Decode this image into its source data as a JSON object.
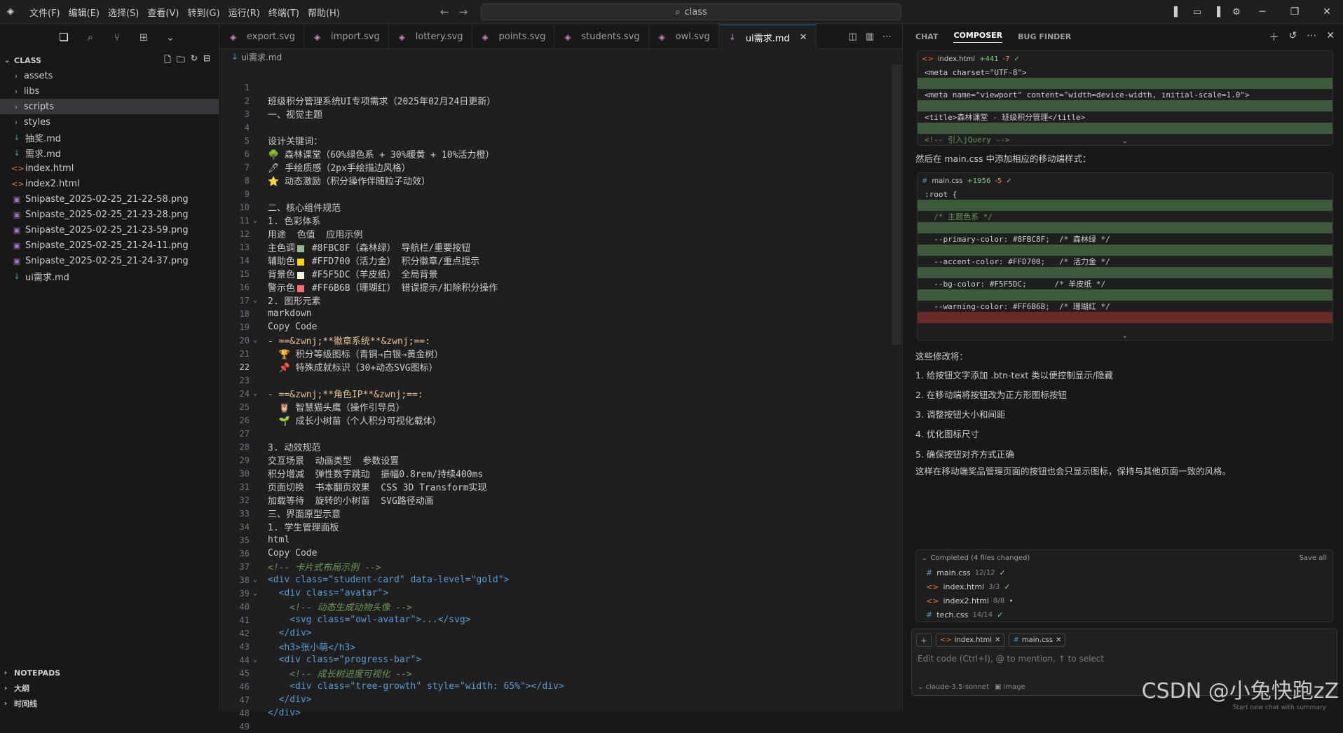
{
  "menus": [
    "文件(F)",
    "编辑(E)",
    "选择(S)",
    "查看(V)",
    "转到(G)",
    "运行(R)",
    "终端(T)",
    "帮助(H)"
  ],
  "search": {
    "label": "class"
  },
  "sidebar": {
    "root": "CLASS",
    "items": [
      {
        "label": "assets",
        "type": "folder"
      },
      {
        "label": "libs",
        "type": "folder"
      },
      {
        "label": "scripts",
        "type": "folder"
      },
      {
        "label": "styles",
        "type": "folder"
      },
      {
        "label": "抽奖.md",
        "type": "md"
      },
      {
        "label": "需求.md",
        "type": "md"
      },
      {
        "label": "index.html",
        "type": "html"
      },
      {
        "label": "index2.html",
        "type": "html"
      },
      {
        "label": "Snipaste_2025-02-25_21-22-58.png",
        "type": "png"
      },
      {
        "label": "Snipaste_2025-02-25_21-23-28.png",
        "type": "png"
      },
      {
        "label": "Snipaste_2025-02-25_21-23-59.png",
        "type": "png"
      },
      {
        "label": "Snipaste_2025-02-25_21-24-11.png",
        "type": "png"
      },
      {
        "label": "Snipaste_2025-02-25_21-24-37.png",
        "type": "png"
      },
      {
        "label": "ui需求.md",
        "type": "md"
      }
    ],
    "bottom": [
      "NOTEPADS",
      "大纲",
      "时间线"
    ]
  },
  "tabs": [
    "export.svg",
    "import.svg",
    "lottery.svg",
    "points.svg",
    "students.svg",
    "owl.svg",
    "ui需求.md"
  ],
  "breadcrumb": "ui需求.md",
  "code": [
    {
      "n": "1",
      "t": ""
    },
    {
      "n": "2",
      "t": "班级积分管理系统UI专项需求（2025年02月24日更新）"
    },
    {
      "n": "3",
      "t": "一、视觉主题"
    },
    {
      "n": "4",
      "t": ""
    },
    {
      "n": "5",
      "t": "设计关键词："
    },
    {
      "n": "6",
      "t": "🌳 森林课堂（60%绿色系 + 30%暖黄 + 10%活力橙）"
    },
    {
      "n": "7",
      "t": "🖊 手绘质感（2px手绘描边风格）"
    },
    {
      "n": "8",
      "t": "⭐ 动态激励（积分操作伴随粒子动效）"
    },
    {
      "n": "9",
      "t": ""
    },
    {
      "n": "10",
      "t": "二、核心组件规范"
    },
    {
      "n": "11",
      "t": "1. 色彩体系"
    },
    {
      "n": "12",
      "t": "用途  色值  应用示例"
    },
    {
      "n": "13",
      "t": "主色调",
      "sw": "#8FBC8F",
      "t2": " #8FBC8F（森林绿） 导航栏/重要按钮"
    },
    {
      "n": "14",
      "t": "辅助色",
      "sw": "#FFD700",
      "t2": " #FFD700（活力金） 积分徽章/重点提示"
    },
    {
      "n": "15",
      "t": "背景色",
      "sw": "#F5F5DC",
      "t2": " #F5F5DC（羊皮纸） 全局背景"
    },
    {
      "n": "16",
      "t": "警示色",
      "sw": "#FF6B6B",
      "t2": " #FF6B6B（珊瑚红） 错误提示/扣除积分操作"
    },
    {
      "n": "17",
      "t": "2. 图形元素"
    },
    {
      "n": "18",
      "t": "markdown"
    },
    {
      "n": "19",
      "t": "Copy Code"
    },
    {
      "n": "20",
      "t": "- ==&zwnj;**徽章系统**&zwnj;==:"
    },
    {
      "n": "21",
      "t": "  🏆 积分等级图标（青铜→白银→黄金树）"
    },
    {
      "n": "22",
      "t": "  📌 特殊成就标识（30+动态SVG图标）"
    },
    {
      "n": "23",
      "t": ""
    },
    {
      "n": "24",
      "t": "- ==&zwnj;**角色IP**&zwnj;==:"
    },
    {
      "n": "25",
      "t": "  🦉 智慧猫头鹰（操作引导员）"
    },
    {
      "n": "26",
      "t": "  🌱 成长小树苗（个人积分可视化载体）"
    },
    {
      "n": "27",
      "t": ""
    },
    {
      "n": "28",
      "t": "3. 动效规范"
    },
    {
      "n": "29",
      "t": "交互场景  动画类型  参数设置"
    },
    {
      "n": "30",
      "t": "积分增减  弹性数字跳动  振幅0.8rem/持续400ms"
    },
    {
      "n": "31",
      "t": "页面切换  书本翻页效果  CSS 3D Transform实现"
    },
    {
      "n": "32",
      "t": "加载等待  旋转的小树苗  SVG路径动画"
    },
    {
      "n": "33",
      "t": "三、界面原型示意"
    },
    {
      "n": "34",
      "t": "1. 学生管理面板"
    },
    {
      "n": "35",
      "t": "html"
    },
    {
      "n": "36",
      "t": "Copy Code"
    },
    {
      "n": "37",
      "t": "<!-- 卡片式布局示例 -->"
    },
    {
      "n": "38",
      "t": "<div class=\"student-card\" data-level=\"gold\">"
    },
    {
      "n": "39",
      "t": "  <div class=\"avatar\">"
    },
    {
      "n": "40",
      "t": "    <!-- 动态生成动物头像 -->"
    },
    {
      "n": "41",
      "t": "    <svg class=\"owl-avatar\">...</svg>"
    },
    {
      "n": "42",
      "t": "  </div>"
    },
    {
      "n": "43",
      "t": "  <h3>张小萌</h3>"
    },
    {
      "n": "44",
      "t": "  <div class=\"progress-bar\">"
    },
    {
      "n": "45",
      "t": "    <!-- 成长树进度可视化 -->"
    },
    {
      "n": "46",
      "t": "    <div class=\"tree-growth\" style=\"width: 65%\"></div>"
    },
    {
      "n": "47",
      "t": "  </div>"
    },
    {
      "n": "48",
      "t": "</div>"
    },
    {
      "n": "49",
      "t": ""
    }
  ],
  "panel": {
    "tabs": [
      "CHAT",
      "COMPOSER",
      "BUG FINDER"
    ],
    "block1": {
      "file": "index.html",
      "plus": "+441",
      "minus": "-7",
      "lines": [
        "<meta charset=\"UTF-8\">",
        "",
        "<meta name=\"viewport\" content=\"width=device-width, initial-scale=1.0\">",
        "",
        "<title>森林课堂 - 班级积分管理</title>",
        "",
        "<!-- 引入jQuery -->"
      ]
    },
    "text1": "然后在 main.css 中添加相应的移动端样式：",
    "block2": {
      "file": "main.css",
      "plus": "+1956",
      "minus": "-5",
      "lines": [
        ":root {",
        "",
        "  /* 主题色系 */",
        "",
        "  --primary-color: #8FBC8F;  /* 森林绿 */",
        "",
        "  --accent-color: #FFD700;   /* 活力金 */",
        "",
        "  --bg-color: #F5F5DC;      /* 羊皮纸 */",
        "",
        "  --warning-color: #FF6B6B;  /* 珊瑚红 */",
        ""
      ]
    },
    "list_title": "这些修改将：",
    "list": [
      "1. 给按钮文字添加 .btn-text 类以便控制显示/隐藏",
      "2. 在移动端将按钮改为正方形图标按钮",
      "3. 调整按钮大小和间距",
      "4. 优化图标尺寸",
      "5. 确保按钮对齐方式正确"
    ],
    "conclusion": "这样在移动端奖品管理页面的按钮也会只显示图标，保持与其他页面一致的风格。",
    "completed": {
      "title": "Completed (4 files changed)",
      "save_all": "Save all",
      "files": [
        {
          "name": "main.css",
          "count": "12/12",
          "icon": "#"
        },
        {
          "name": "index.html",
          "count": "3/3",
          "icon": "<>"
        },
        {
          "name": "index2.html",
          "count": "8/8",
          "icon": "<>"
        },
        {
          "name": "tech.css",
          "count": "14/14",
          "icon": "#"
        }
      ]
    },
    "composer": {
      "chips": [
        "index.html",
        "main.css"
      ],
      "placeholder": "Edit code (Ctrl+I), @ to mention, ↑ to select",
      "model": "claude-3.5-sonnet",
      "image": "image"
    },
    "footer_hint": "Start new chat with summary"
  },
  "watermark": "CSDN @小兔快跑zZ"
}
